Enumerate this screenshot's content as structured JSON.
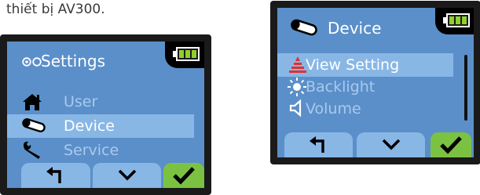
{
  "caption": "thiết bị AV300.",
  "colors": {
    "lcd_background": "#5b8fc9",
    "selected_row": "#88b7e6",
    "dimmed_text": "#a9c9ee",
    "active_text": "#ffffff",
    "ok_button": "#7cc242",
    "battery_fill": "#8fd12a",
    "view_setting_icon": "#e0312f"
  },
  "screen_settings": {
    "header": {
      "icon": "settings-circles-icon",
      "title": "Settings"
    },
    "battery": {
      "icon": "battery-icon",
      "level": 1.0
    },
    "items": [
      {
        "icon": "house-icon",
        "label": "User",
        "selected": false
      },
      {
        "icon": "microphone-handset-icon",
        "label": "Device",
        "selected": true
      },
      {
        "icon": "wrench-icon",
        "label": "Service",
        "selected": false
      }
    ],
    "buttons": [
      {
        "icon": "back-arrow-icon",
        "role": "back"
      },
      {
        "icon": "chevron-down-icon",
        "role": "down"
      },
      {
        "icon": "checkmark-icon",
        "role": "confirm"
      }
    ]
  },
  "screen_device": {
    "header": {
      "icon": "microphone-handset-icon",
      "title": "Device"
    },
    "battery": {
      "icon": "battery-icon",
      "level": 1.0
    },
    "items": [
      {
        "icon": "view-setting-icon",
        "label": "View Setting",
        "selected": true
      },
      {
        "icon": "sun-icon",
        "label": "Backlight",
        "selected": false
      },
      {
        "icon": "speaker-icon",
        "label": "Volume",
        "selected": false
      }
    ],
    "buttons": [
      {
        "icon": "back-arrow-icon",
        "role": "back"
      },
      {
        "icon": "chevron-down-icon",
        "role": "down"
      },
      {
        "icon": "checkmark-icon",
        "role": "confirm"
      }
    ]
  }
}
